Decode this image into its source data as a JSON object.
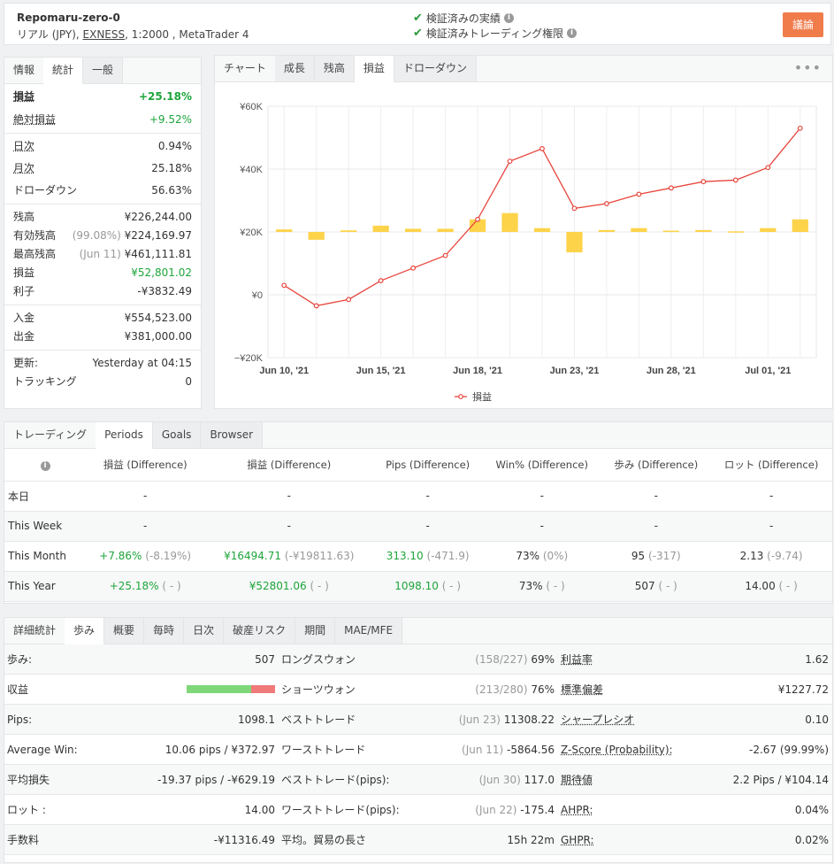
{
  "header": {
    "title": "Repomaru-zero-0",
    "account_prefix": "リアル (JPY), ",
    "broker": "EXNESS",
    "account_suffix": ", 1:2000 , MetaTrader 4",
    "verified_track": "検証済みの実績",
    "verified_trading": "検証済みトレーディング権限",
    "discuss_button": "議論"
  },
  "stats": {
    "tabs": [
      "情報",
      "統計",
      "一般"
    ],
    "active_tab": "統計",
    "gain_label": "損益",
    "gain": "+25.18%",
    "abs_gain_label": "絶対損益",
    "abs_gain": "+9.52%",
    "daily_label": "日次",
    "daily": "0.94%",
    "monthly_label": "月次",
    "monthly": "25.18%",
    "drawdown_label": "ドローダウン",
    "drawdown": "56.63%",
    "balance_label": "残高",
    "balance": "¥226,244.00",
    "equity_label": "有効残高",
    "equity_pct": "(99.08%)",
    "equity": "¥224,169.97",
    "highest_label": "最高残高",
    "highest_date": "(Jun 11)",
    "highest": "¥461,111.81",
    "profit_label": "損益",
    "profit": "¥52,801.02",
    "interest_label": "利子",
    "interest": "-¥3832.49",
    "deposits_label": "入金",
    "deposits": "¥554,523.00",
    "withdrawals_label": "出金",
    "withdrawals": "¥381,000.00",
    "updated_label": "更新:",
    "updated": "Yesterday at 04:15",
    "tracking_label": "トラッキング",
    "tracking": "0"
  },
  "chart_panel": {
    "tabs": [
      "チャート",
      "成長",
      "残高",
      "損益",
      "ドローダウン"
    ],
    "active_tab": "損益",
    "menu_glyph": "•••"
  },
  "chart_data": {
    "type": "bar+line",
    "y_tick_labels": [
      "¥60K",
      "¥40K",
      "¥20K",
      "¥0",
      "−¥20K"
    ],
    "y_ticks": [
      60000,
      40000,
      20000,
      0,
      -20000
    ],
    "ylim": [
      -20000,
      60000
    ],
    "x_tick_labels": [
      "Jun 10, '21",
      "Jun 15, '21",
      "Jun 18, '21",
      "Jun 23, '21",
      "Jun 28, '21",
      "Jul 01, '21"
    ],
    "x_tick_index": [
      0,
      3,
      6,
      9,
      12,
      15
    ],
    "x_dates": [
      "Jun 10",
      "Jun 11",
      "Jun 14",
      "Jun 15",
      "Jun 16",
      "Jun 17",
      "Jun 18",
      "Jun 21",
      "Jun 22",
      "Jun 23",
      "Jun 24",
      "Jun 25",
      "Jun 28",
      "Jun 29",
      "Jun 30",
      "Jul 01",
      "Jul 02"
    ],
    "bars": [
      800,
      -2500,
      500,
      2000,
      1000,
      1000,
      4000,
      6000,
      1200,
      -6500,
      600,
      1200,
      400,
      600,
      200,
      1200,
      4000
    ],
    "series": [
      {
        "name": "損益",
        "color": "#e8453c",
        "values": [
          3000,
          -3500,
          -1500,
          4500,
          8500,
          12500,
          24000,
          42500,
          46500,
          27500,
          29000,
          32000,
          34000,
          36000,
          36500,
          40500,
          53000
        ]
      }
    ],
    "bar_color": "#fdd34a",
    "grid": true,
    "legend_position": "bottom"
  },
  "periods": {
    "tabs": [
      "トレーディング",
      "Periods",
      "Goals",
      "Browser"
    ],
    "active_tab": "Periods",
    "columns": [
      "損益 (Difference)",
      "損益 (Difference)",
      "Pips (Difference)",
      "Win% (Difference)",
      "歩み (Difference)",
      "ロット (Difference)"
    ],
    "rows": [
      {
        "label": "本日",
        "cells": [
          [
            "-",
            ""
          ],
          [
            "-",
            ""
          ],
          [
            "-",
            ""
          ],
          [
            "-",
            ""
          ],
          [
            "-",
            ""
          ],
          [
            "-",
            ""
          ]
        ]
      },
      {
        "label": "This Week",
        "cells": [
          [
            "-",
            ""
          ],
          [
            "-",
            ""
          ],
          [
            "-",
            ""
          ],
          [
            "-",
            ""
          ],
          [
            "-",
            ""
          ],
          [
            "-",
            ""
          ]
        ]
      },
      {
        "label": "This Month",
        "cells": [
          [
            "+7.86%",
            "(-8.19%)"
          ],
          [
            "¥16494.71",
            "(-¥19811.63)"
          ],
          [
            "313.10",
            "(-471.9)"
          ],
          [
            "73%",
            "(0%)"
          ],
          [
            "95",
            "(-317)"
          ],
          [
            "2.13",
            "(-9.74)"
          ]
        ]
      },
      {
        "label": "This Year",
        "cells": [
          [
            "+25.18%",
            "( - )"
          ],
          [
            "¥52801.06",
            "( - )"
          ],
          [
            "1098.10",
            "( - )"
          ],
          [
            "73%",
            "( - )"
          ],
          [
            "507",
            "( - )"
          ],
          [
            "14.00",
            "( - )"
          ]
        ]
      }
    ]
  },
  "detail": {
    "tabs": [
      "詳細統計",
      "歩み",
      "概要",
      "毎時",
      "日次",
      "破産リスク",
      "期間",
      "MAE/MFE"
    ],
    "active_tab": "歩み",
    "profit_bar_green_fraction": 0.73,
    "col1": [
      {
        "label": "歩み:",
        "value": "507"
      },
      {
        "label": "収益",
        "value": ""
      },
      {
        "label": "Pips:",
        "value": "1098.1"
      },
      {
        "label": "Average Win:",
        "value": "10.06 pips / ¥372.97"
      },
      {
        "label": "平均損失",
        "value": "-19.37 pips / -¥629.19"
      },
      {
        "label": "ロット :",
        "value": "14.00"
      },
      {
        "label": "手数料",
        "value": "-¥11316.49"
      }
    ],
    "col2": [
      {
        "label": "ロングスウォン",
        "note": "(158/227)",
        "value": "69%"
      },
      {
        "label": "ショーツウォン",
        "note": "(213/280)",
        "value": "76%"
      },
      {
        "label": "ベストトレード",
        "note": "(Jun 23)",
        "value": "11308.22"
      },
      {
        "label": "ワーストトレード",
        "note": "(Jun 11)",
        "value": "-5864.56"
      },
      {
        "label": "ベストトレード(pips):",
        "note": "(Jun 30)",
        "value": "117.0"
      },
      {
        "label": "ワーストトレード(pips):",
        "note": "(Jun 22)",
        "value": "-175.4"
      },
      {
        "label": "平均。貿易の長さ",
        "note": "",
        "value": "15h 22m"
      }
    ],
    "col3": [
      {
        "label": "利益率",
        "value": "1.62"
      },
      {
        "label": "標準偏差",
        "value": "¥1227.72"
      },
      {
        "label": "シャープレシオ",
        "value": "0.10"
      },
      {
        "label": "Z-Score (Probability):",
        "value": "-2.67 (99.99%)"
      },
      {
        "label": "期待値",
        "value": "2.2 Pips / ¥104.14"
      },
      {
        "label": "AHPR:",
        "value": "0.04%"
      },
      {
        "label": "GHPR:",
        "value": "0.02%"
      }
    ]
  }
}
